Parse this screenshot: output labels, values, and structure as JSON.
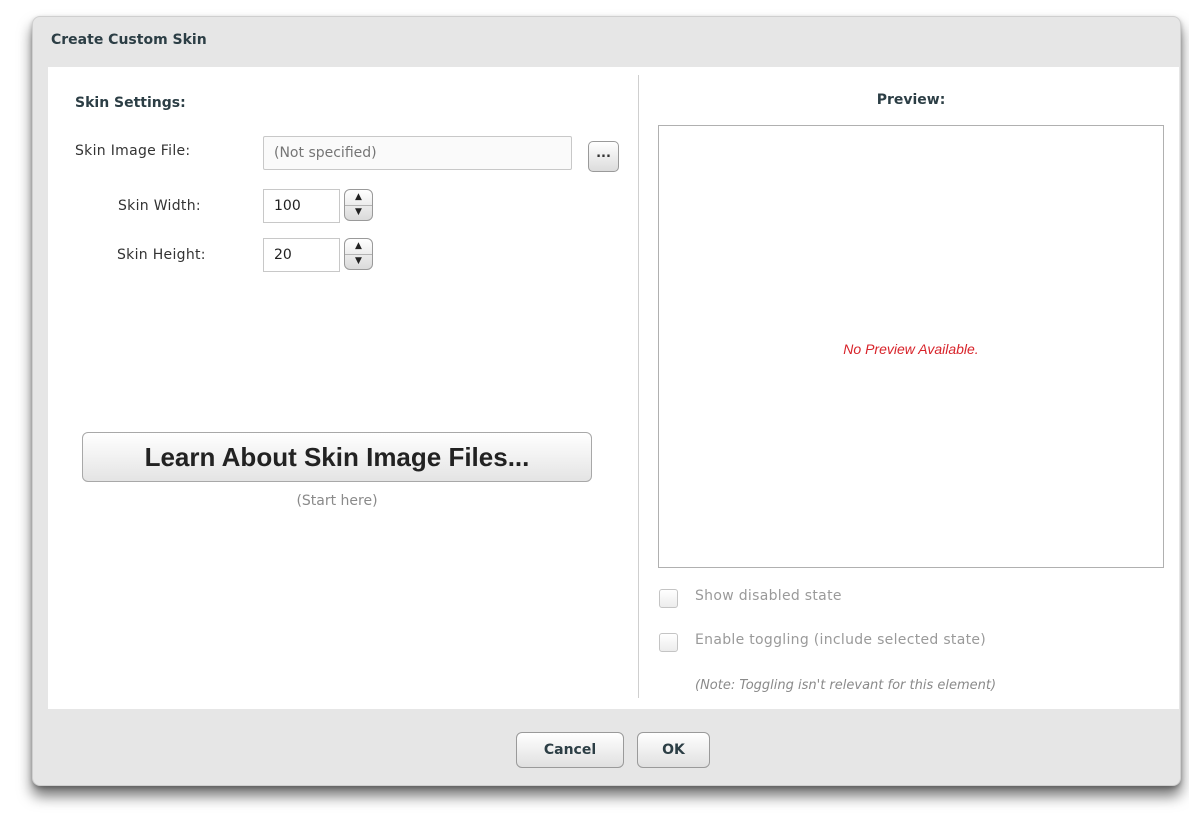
{
  "dialog": {
    "title": "Create Custom Skin"
  },
  "settings": {
    "section_label": "Skin Settings:",
    "image_file_label": "Skin Image File:",
    "image_file_placeholder": "(Not specified)",
    "browse_label": "...",
    "width_label": "Skin Width:",
    "width_value": "100",
    "height_label": "Skin Height:",
    "height_value": "20",
    "stepper_up": "▲",
    "stepper_down": "▼"
  },
  "learn": {
    "button_label": "Learn About Skin Image Files...",
    "hint": "(Start here)"
  },
  "preview": {
    "label": "Preview:",
    "empty_message": "No Preview Available.",
    "show_disabled_label": "Show disabled state",
    "show_disabled_checked": false,
    "enable_toggling_label": "Enable toggling (include selected state)",
    "enable_toggling_checked": false,
    "note": "(Note: Toggling isn't relevant for this element)"
  },
  "footer": {
    "cancel_label": "Cancel",
    "ok_label": "OK"
  },
  "colors": {
    "title_text": "#2c3e45",
    "error_text": "#d8232a",
    "dialog_bg": "#e6e6e6"
  }
}
